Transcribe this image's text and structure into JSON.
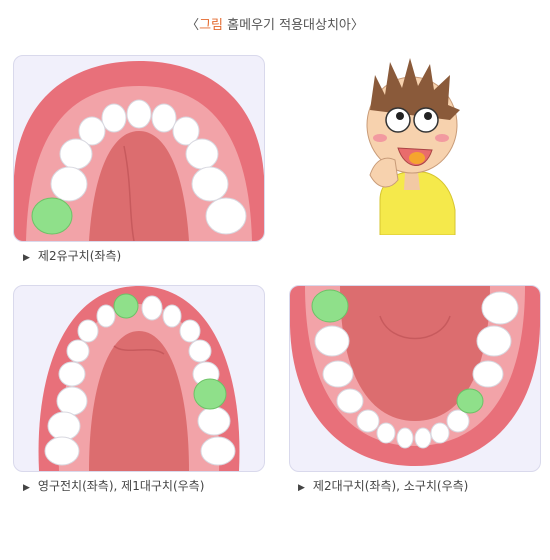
{
  "title": {
    "bracket_open": "〈",
    "label": "그림",
    "text": "홈메우기 적용대상치아",
    "bracket_close": "〉",
    "accent_color": "#e46a2e"
  },
  "panels": [
    {
      "caption": "제2유구치(좌측)"
    },
    {
      "caption": "영구전치(좌측), 제1대구치(우측)"
    },
    {
      "caption": "제2대구치(좌측), 소구치(우측)"
    }
  ],
  "caption_marker": "▶",
  "colors": {
    "gum": "#e8707a",
    "gum_inner": "#f2a3a8",
    "palate": "#dc6d6f",
    "tooth": "#ffffff",
    "highlight_tooth": "#8fe08a",
    "panel_bg": "#f1f0fb"
  },
  "icons": [
    "triangle-right-icon",
    "boy-character-illustration"
  ]
}
